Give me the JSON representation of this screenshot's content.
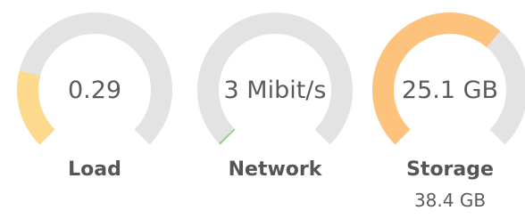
{
  "gauges": [
    {
      "id": "load",
      "value_text": "0.29",
      "label": "Load",
      "sub": "",
      "fraction": 0.22,
      "color": "#fcd98d"
    },
    {
      "id": "network",
      "value_text": "3 Mibit/s",
      "label": "Network",
      "sub": "",
      "fraction": 0.005,
      "color": "#8ccf7e"
    },
    {
      "id": "storage",
      "value_text": "25.1 GB",
      "label": "Storage",
      "sub": "38.4 GB",
      "fraction": 0.65,
      "color": "#fdc27b"
    }
  ],
  "colors": {
    "track": "#e3e3e3",
    "text": "#5b5b5b",
    "label": "#555555"
  }
}
